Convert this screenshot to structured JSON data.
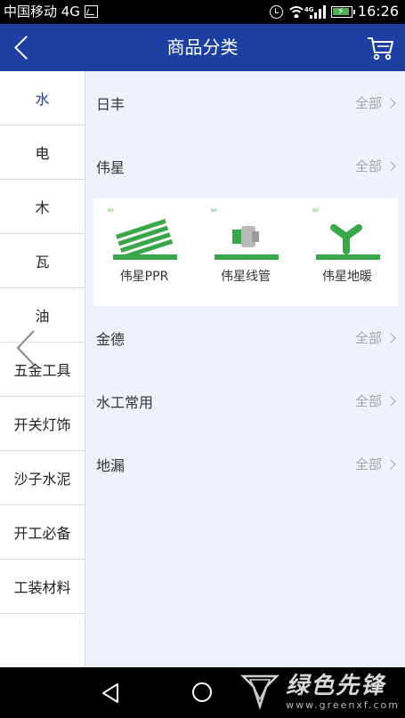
{
  "status_bar": {
    "carrier": "中国移动 4G",
    "network_tag": "4G",
    "time": "16:26"
  },
  "header": {
    "title": "商品分类"
  },
  "sidebar": {
    "items": [
      {
        "label": "水",
        "active": true
      },
      {
        "label": "电"
      },
      {
        "label": "木"
      },
      {
        "label": "瓦"
      },
      {
        "label": "油"
      },
      {
        "label": "五金工具"
      },
      {
        "label": "开关灯饰"
      },
      {
        "label": "沙子水泥"
      },
      {
        "label": "开工必备"
      },
      {
        "label": "工装材料"
      }
    ]
  },
  "brands": [
    {
      "name": "日丰",
      "more": "全部"
    },
    {
      "name": "伟星",
      "more": "全部"
    },
    {
      "name": "金德",
      "more": "全部"
    },
    {
      "name": "水工常用",
      "more": "全部"
    },
    {
      "name": "地漏",
      "more": "全部"
    }
  ],
  "subcategories": [
    {
      "label": "伟星PPR",
      "icon": "ppr-pipes-image"
    },
    {
      "label": "伟星线管",
      "icon": "pipe-fitting-image"
    },
    {
      "label": "伟星地暖",
      "icon": "y-fitting-image"
    }
  ],
  "watermark": {
    "title": "绿色先锋",
    "url": "www.greenxf.com"
  },
  "colors": {
    "primary": "#1d3fa4",
    "pipe_green": "#3aa64a"
  }
}
